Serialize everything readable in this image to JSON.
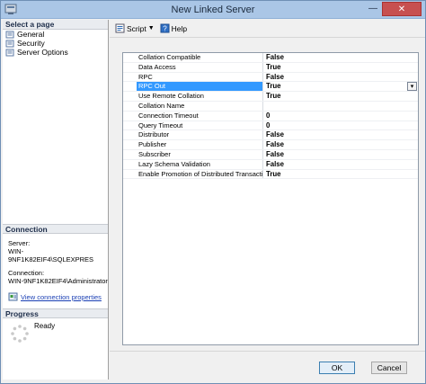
{
  "window": {
    "title": "New Linked Server",
    "minimize": "—",
    "close": "✕"
  },
  "left": {
    "select_page_header": "Select a page",
    "pages": [
      {
        "label": "General"
      },
      {
        "label": "Security"
      },
      {
        "label": "Server Options"
      }
    ],
    "connection_header": "Connection",
    "server_label": "Server:",
    "server_value": "WIN-9NF1K82EIF4\\SQLEXPRES",
    "connection_label": "Connection:",
    "connection_value": "WIN-9NF1K82EIF4\\Administrator",
    "view_link": "View connection properties",
    "progress_header": "Progress",
    "progress_status": "Ready"
  },
  "toolbar": {
    "script_label": "Script",
    "help_label": "Help"
  },
  "properties": [
    {
      "name": "Collation Compatible",
      "value": "False"
    },
    {
      "name": "Data Access",
      "value": "True"
    },
    {
      "name": "RPC",
      "value": "False"
    },
    {
      "name": "RPC Out",
      "value": "True"
    },
    {
      "name": "Use Remote Collation",
      "value": "True"
    },
    {
      "name": "Collation Name",
      "value": ""
    },
    {
      "name": "Connection Timeout",
      "value": "0"
    },
    {
      "name": "Query Timeout",
      "value": "0"
    },
    {
      "name": "Distributor",
      "value": "False"
    },
    {
      "name": "Publisher",
      "value": "False"
    },
    {
      "name": "Subscriber",
      "value": "False"
    },
    {
      "name": "Lazy Schema Validation",
      "value": "False"
    },
    {
      "name": "Enable Promotion of Distributed Transaction",
      "value": "True"
    }
  ],
  "footer": {
    "ok_label": "OK",
    "cancel_label": "Cancel"
  }
}
